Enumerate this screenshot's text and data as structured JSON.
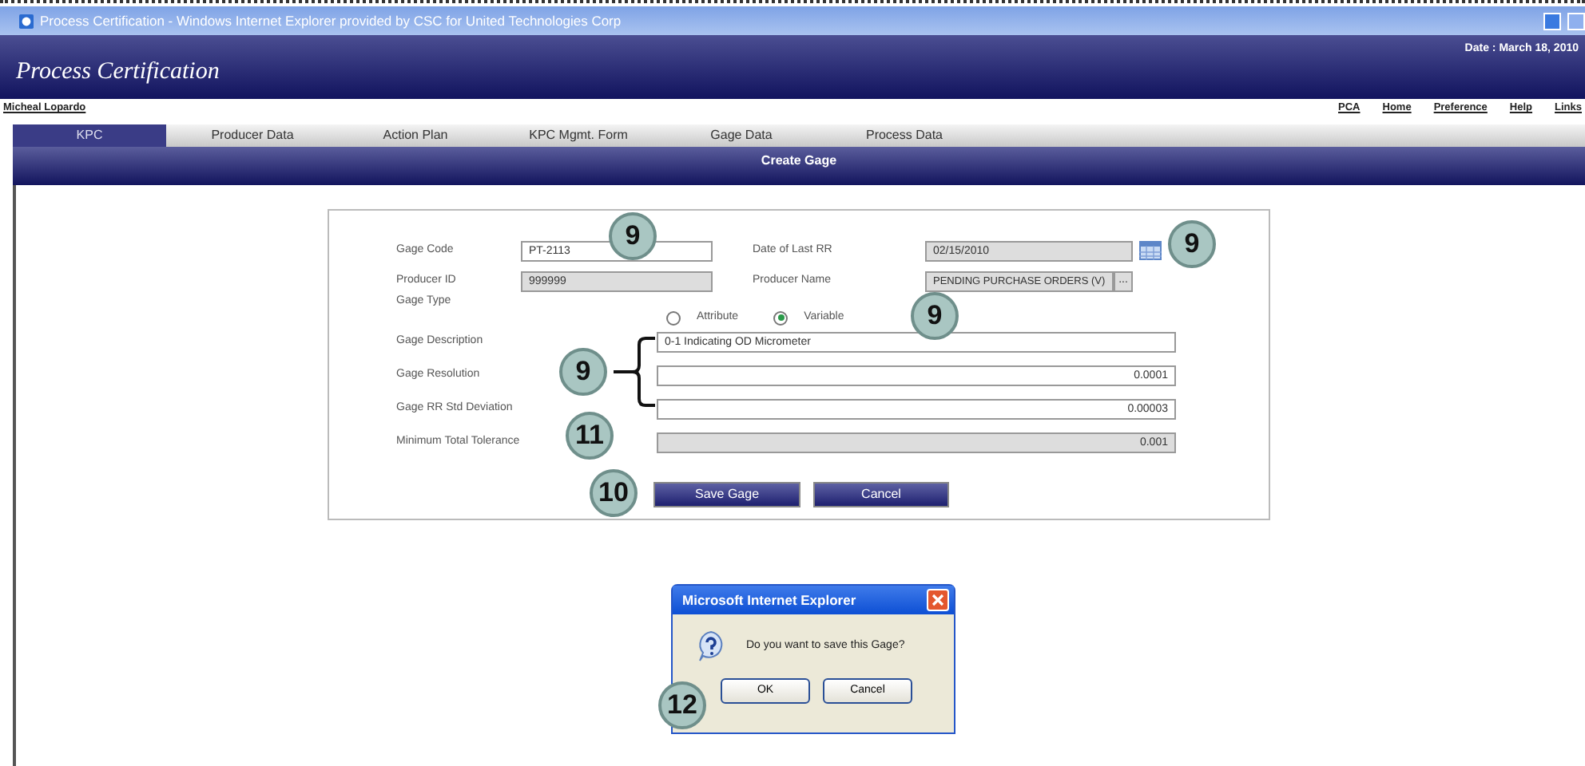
{
  "window": {
    "title": "Process Certification - Windows Internet Explorer provided by CSC for United Technologies Corp"
  },
  "header": {
    "title": "Process Certification",
    "date": "Date : March 18, 2010"
  },
  "user": "Micheal Lopardo",
  "links": [
    "PCA",
    "Home",
    "Preference",
    "Help",
    "Links"
  ],
  "tabs": [
    {
      "label": "KPC",
      "selected": true
    },
    {
      "label": "Producer Data",
      "selected": false
    },
    {
      "label": "Action Plan",
      "selected": false
    },
    {
      "label": "KPC Mgmt. Form",
      "selected": false
    },
    {
      "label": "Gage Data",
      "selected": false
    },
    {
      "label": "Process Data",
      "selected": false
    }
  ],
  "section_title": "Create Gage",
  "form": {
    "gage_code": {
      "label": "Gage Code",
      "value": "PT-2113"
    },
    "date_of_last_rr": {
      "label": "Date of Last RR",
      "value": "02/15/2010"
    },
    "producer_id": {
      "label": "Producer ID",
      "value": "999999"
    },
    "producer_name": {
      "label": "Producer Name",
      "value": "PENDING PURCHASE ORDERS (V)",
      "button": "..."
    },
    "gage_type": {
      "label": "Gage Type",
      "options": [
        {
          "label": "Attribute",
          "selected": false
        },
        {
          "label": "Variable",
          "selected": true
        }
      ]
    },
    "gage_description": {
      "label": "Gage Description",
      "value": "0-1 Indicating OD Micrometer"
    },
    "gage_resolution": {
      "label": "Gage Resolution",
      "value": "0.0001"
    },
    "gage_rr_std_deviation": {
      "label": "Gage RR Std Deviation",
      "value": "0.00003"
    },
    "minimum_total_tolerance": {
      "label": "Minimum Total Tolerance",
      "value": "0.001"
    },
    "buttons": [
      "Save Gage",
      "Cancel"
    ]
  },
  "dialog": {
    "title": "Microsoft Internet Explorer",
    "message": "Do you want to save this Gage?",
    "buttons": [
      "OK",
      "Cancel"
    ]
  },
  "callouts": [
    {
      "label": "9"
    },
    {
      "label": "9"
    },
    {
      "label": "9"
    },
    {
      "label": "9"
    },
    {
      "label": "11"
    },
    {
      "label": "10"
    },
    {
      "label": "12"
    }
  ]
}
